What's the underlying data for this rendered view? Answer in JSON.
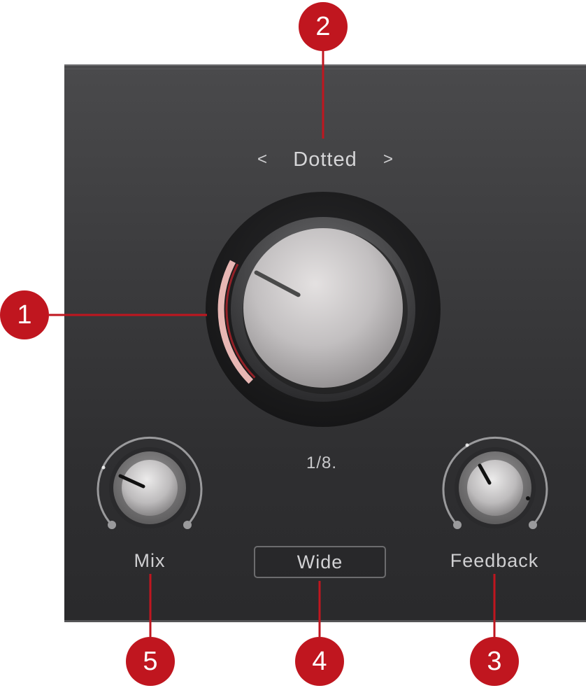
{
  "panel": {
    "selector": {
      "prev_glyph": "<",
      "label": "Dotted",
      "next_glyph": ">"
    },
    "main_knob": {
      "value_text": "1/8.",
      "level": 0.27,
      "accent": "#e8b7b4"
    },
    "mix_knob": {
      "label": "Mix"
    },
    "feedback_knob": {
      "label": "Feedback"
    },
    "wide_button": {
      "label": "Wide"
    }
  },
  "callouts": {
    "one": "1",
    "two": "2",
    "three": "3",
    "four": "4",
    "five": "5"
  },
  "colors": {
    "callout": "#c0161f",
    "panel": "#3c3c3e"
  }
}
